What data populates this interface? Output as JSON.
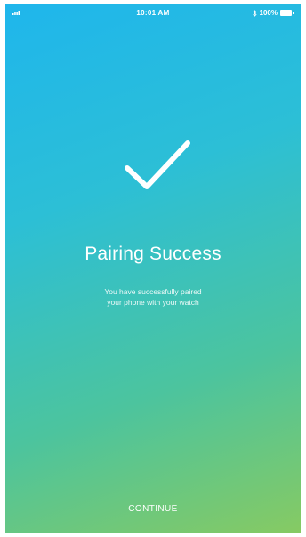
{
  "status_bar": {
    "time": "10:01 AM",
    "battery": "100%",
    "icons": [
      "signal-icon",
      "bluetooth-icon",
      "battery-icon"
    ]
  },
  "main": {
    "icon": "checkmark-icon",
    "title": "Pairing Success",
    "message_line1": "You have successfully paired",
    "message_line2": "your phone with your watch"
  },
  "footer": {
    "continue_label": "CONTINUE"
  },
  "colors": {
    "gradient_top": "#1fb6ec",
    "gradient_bottom": "#86ca63",
    "text": "#ffffff"
  }
}
